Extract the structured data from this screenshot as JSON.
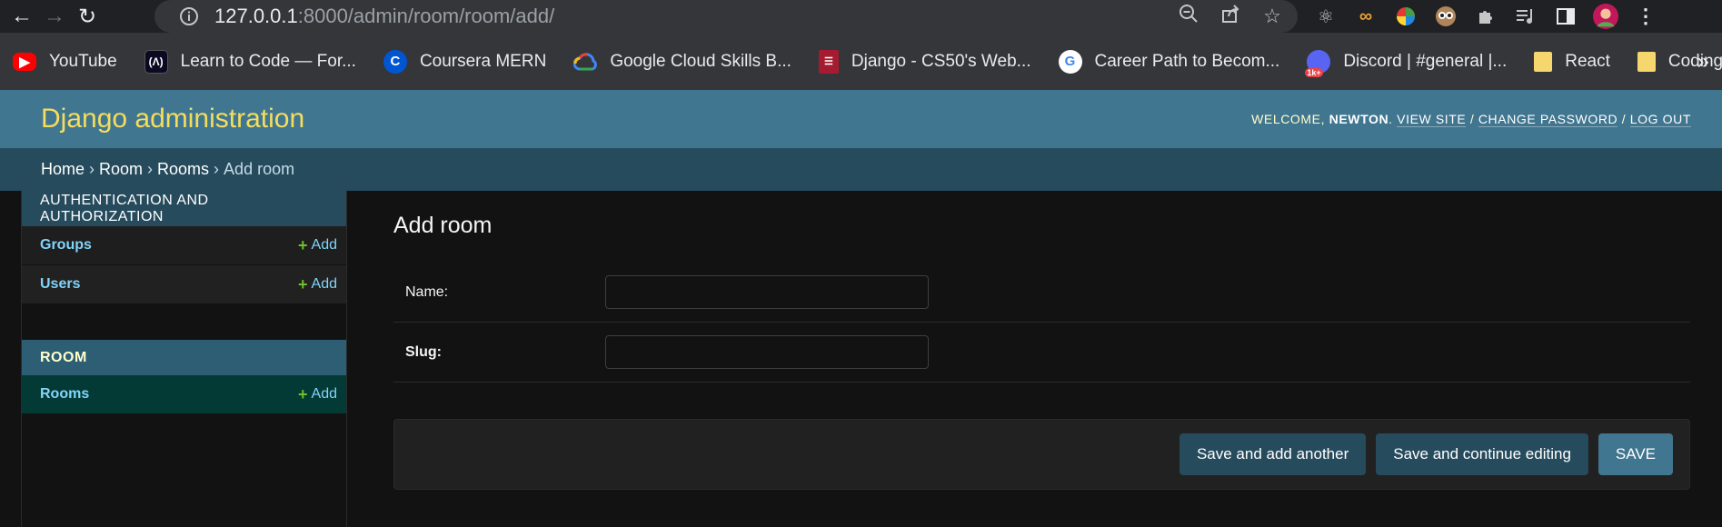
{
  "browser": {
    "url_host": "127.0.0.1",
    "url_rest": ":8000/admin/room/room/add/",
    "bookmarks": [
      {
        "label": "YouTube",
        "icon": "youtube-icon",
        "color": "#ff0000"
      },
      {
        "label": "Learn to Code — For...",
        "icon": "freecodecamp-icon",
        "color": "#0a0a23"
      },
      {
        "label": "Coursera MERN",
        "icon": "coursera-icon",
        "color": "#0056d2"
      },
      {
        "label": "Google Cloud Skills B...",
        "icon": "google-cloud-icon",
        "color": "#4285f4"
      },
      {
        "label": "Django - CS50's Web...",
        "icon": "harvard-icon",
        "color": "#a51c30"
      },
      {
        "label": "Career Path to Becom...",
        "icon": "google-g-icon",
        "color": "#ffffff"
      },
      {
        "label": "Discord | #general |...",
        "icon": "discord-icon",
        "color": "#5865f2"
      },
      {
        "label": "React",
        "icon": "folder-icon",
        "color": "#f5d76e"
      },
      {
        "label": "Coding",
        "icon": "folder-icon",
        "color": "#f5d76e"
      }
    ],
    "discord_badge": "1k+"
  },
  "header": {
    "branding": "Django administration",
    "welcome": "WELCOME,",
    "username": "NEWTON",
    "view_site": "VIEW SITE",
    "change_password": "CHANGE PASSWORD",
    "log_out": "LOG OUT"
  },
  "breadcrumbs": {
    "home": "Home",
    "app": "Room",
    "model": "Rooms",
    "current": "Add room"
  },
  "sidebar": {
    "auth_caption": "AUTHENTICATION AND AUTHORIZATION",
    "groups": "Groups",
    "users": "Users",
    "room_caption": "ROOM",
    "rooms": "Rooms",
    "add_label": "Add"
  },
  "main": {
    "title": "Add room",
    "name_label": "Name:",
    "slug_label": "Slug:",
    "name_value": "",
    "slug_value": ""
  },
  "actions": {
    "save_add_another": "Save and add another",
    "save_continue": "Save and continue editing",
    "save": "SAVE"
  },
  "colors": {
    "header_bg": "#417690",
    "branding": "#f5dd5d",
    "breadcrumbs_bg": "#264b5d",
    "link": "#81d4fa",
    "add_plus": "#70bf2b"
  }
}
